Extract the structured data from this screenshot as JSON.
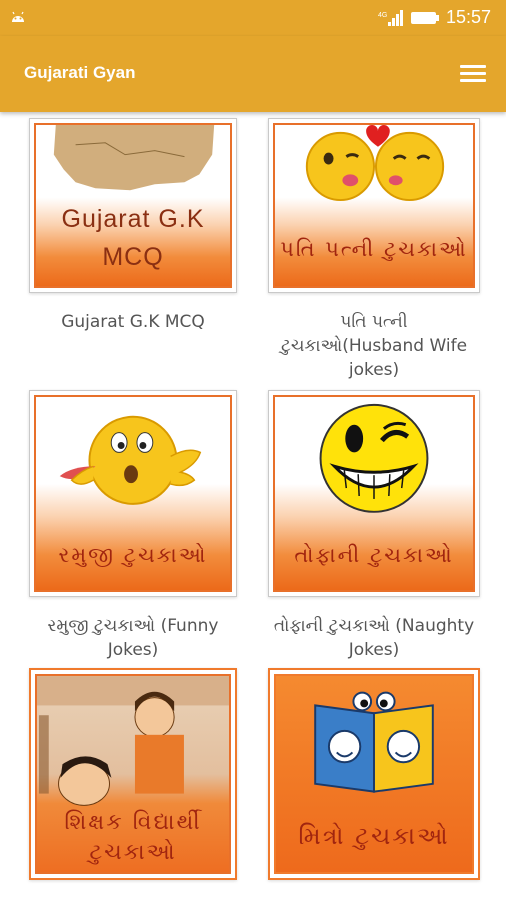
{
  "status_bar": {
    "time": "15:57"
  },
  "app_bar": {
    "title": "Gujarati Gyan"
  },
  "tiles": [
    {
      "tile_text_line1": "Gujarat G.K",
      "tile_text_line2": "MCQ",
      "caption": "Gujarat G.K MCQ"
    },
    {
      "tile_text": "પતિ પત્ની ટુચકાઓ",
      "caption": "પતિ પત્ની ટુચકાઓ(Husband Wife jokes)"
    },
    {
      "tile_text": "રમુજી ટુચકાઓ",
      "caption": "રમુજી ટુચકાઓ (Funny Jokes)"
    },
    {
      "tile_text": "તોફાની ટુચકાઓ",
      "caption": "તોફાની ટુચકાઓ (Naughty Jokes)"
    },
    {
      "tile_text_line1": "શિક્ષક વિદ્યાર્થી",
      "tile_text_line2": "ટુચકાઓ"
    },
    {
      "tile_text": "મિત્રો ટુચકાઓ"
    }
  ],
  "colors": {
    "app_bar": "#e4a62c",
    "tile_border": "#e8702a",
    "tile_text": "#a1250f"
  }
}
